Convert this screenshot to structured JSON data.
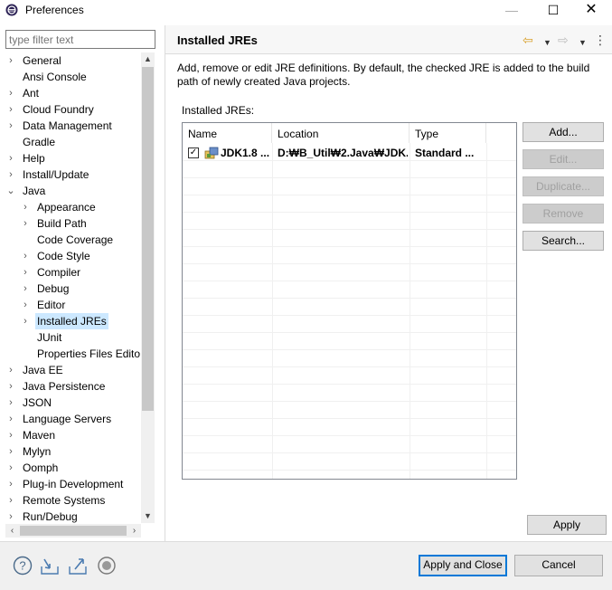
{
  "window": {
    "title": "Preferences",
    "controls": {
      "minimize": "—",
      "maximize": "☐",
      "close": "✕"
    }
  },
  "left": {
    "filter_placeholder": "type filter text",
    "tree": [
      {
        "label": "General",
        "indent": 0,
        "expander": "›"
      },
      {
        "label": "Ansi Console",
        "indent": 0,
        "expander": ""
      },
      {
        "label": "Ant",
        "indent": 0,
        "expander": "›"
      },
      {
        "label": "Cloud Foundry",
        "indent": 0,
        "expander": "›"
      },
      {
        "label": "Data Management",
        "indent": 0,
        "expander": "›"
      },
      {
        "label": "Gradle",
        "indent": 0,
        "expander": ""
      },
      {
        "label": "Help",
        "indent": 0,
        "expander": "›"
      },
      {
        "label": "Install/Update",
        "indent": 0,
        "expander": "›"
      },
      {
        "label": "Java",
        "indent": 0,
        "expander": "⌄"
      },
      {
        "label": "Appearance",
        "indent": 1,
        "expander": "›"
      },
      {
        "label": "Build Path",
        "indent": 1,
        "expander": "›"
      },
      {
        "label": "Code Coverage",
        "indent": 1,
        "expander": ""
      },
      {
        "label": "Code Style",
        "indent": 1,
        "expander": "›"
      },
      {
        "label": "Compiler",
        "indent": 1,
        "expander": "›"
      },
      {
        "label": "Debug",
        "indent": 1,
        "expander": "›"
      },
      {
        "label": "Editor",
        "indent": 1,
        "expander": "›"
      },
      {
        "label": "Installed JREs",
        "indent": 1,
        "expander": "›",
        "selected": true
      },
      {
        "label": "JUnit",
        "indent": 1,
        "expander": ""
      },
      {
        "label": "Properties Files Edito",
        "indent": 1,
        "expander": ""
      },
      {
        "label": "Java EE",
        "indent": 0,
        "expander": "›"
      },
      {
        "label": "Java Persistence",
        "indent": 0,
        "expander": "›"
      },
      {
        "label": "JSON",
        "indent": 0,
        "expander": "›"
      },
      {
        "label": "Language Servers",
        "indent": 0,
        "expander": "›"
      },
      {
        "label": "Maven",
        "indent": 0,
        "expander": "›"
      },
      {
        "label": "Mylyn",
        "indent": 0,
        "expander": "›"
      },
      {
        "label": "Oomph",
        "indent": 0,
        "expander": "›"
      },
      {
        "label": "Plug-in Development",
        "indent": 0,
        "expander": "›"
      },
      {
        "label": "Remote Systems",
        "indent": 0,
        "expander": "›"
      },
      {
        "label": "Run/Debug",
        "indent": 0,
        "expander": "›"
      }
    ]
  },
  "page": {
    "title": "Installed JREs",
    "description": "Add, remove or edit JRE definitions. By default, the checked JRE is added to the build path of newly created Java projects.",
    "list_label": "Installed JREs:",
    "columns": {
      "name": "Name",
      "location": "Location",
      "type": "Type"
    },
    "rows": [
      {
        "checked": true,
        "check_glyph": "✓",
        "name": "JDK1.8 ...",
        "location": "D:₩B_Util₩2.Java₩JDK...",
        "type": "Standard ..."
      }
    ],
    "buttons": {
      "add": "Add...",
      "edit": "Edit...",
      "duplicate": "Duplicate...",
      "remove": "Remove",
      "search": "Search..."
    },
    "apply": "Apply"
  },
  "footer": {
    "apply_and_close": "Apply and Close",
    "cancel": "Cancel"
  },
  "colors": {
    "selection": "#cce8ff",
    "default_button_border": "#0078d7",
    "back_arrow": "#d9a02b"
  }
}
